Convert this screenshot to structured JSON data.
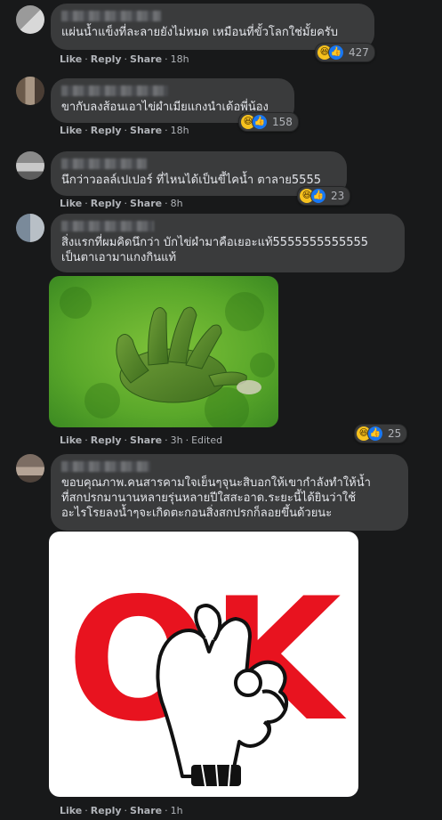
{
  "comments": [
    {
      "text": "แผ่นน้ำแข็งที่ละลายยังไม่หมด เหมือนที่ขั้วโลกใช่มั้ยครับ",
      "reaction_count": "427",
      "actions": {
        "like": "Like",
        "reply": "Reply",
        "share": "Share",
        "time": "18h"
      }
    },
    {
      "text": "ขากับลงส้อนเอาไข่ผำเมียแกงนำเด้อพี่น้อง",
      "reaction_count": "158",
      "actions": {
        "like": "Like",
        "reply": "Reply",
        "share": "Share",
        "time": "18h"
      }
    },
    {
      "text": "นึกว่าวอลล์เปเปอร์ ที่ไหนได้เป็นขี้ไคน้ำ ตาลาย5555",
      "reaction_count": "23",
      "actions": {
        "like": "Like",
        "reply": "Reply",
        "share": "Share",
        "time": "8h"
      }
    },
    {
      "text": "สิ่งแรกที่ผมคิดนึกว่า บักไข่ผำมาคือเยอะแท้5555555555555\nเป็นตาเอามาแกงกินแท้",
      "reaction_count": "25",
      "actions": {
        "like": "Like",
        "reply": "Reply",
        "share": "Share",
        "time": "3h",
        "edited": "Edited"
      }
    },
    {
      "text": "ขอบคุณภาพ.คนสารคามใจเย็นๆจุนะสิบอกให้เขากำลังทำให้น้ำ\nที่สกปรกมานานหลายรุ่นหลายปีใสสะอาด.ระยะนี้ได้ยินว่าใช้\nอะไรโรยลงน้ำๆจะเกิดตะกอนสิ่งสกปรกก็ลอยขึ้นด้วยนะ",
      "actions": {
        "like": "Like",
        "reply": "Reply",
        "share": "Share",
        "time": "1h"
      }
    }
  ],
  "sticker": {
    "letters": "OK"
  },
  "colors": {
    "bg": "#18191a",
    "bubble": "#3a3b3c",
    "text": "#e4e6eb",
    "muted": "#b0b3b8",
    "like_blue": "#1877f2",
    "haha_yellow": "#f7c21e",
    "ok_red": "#e8131f"
  },
  "icons": {
    "haha": "haha-emoji-icon",
    "like": "thumbs-up-icon"
  }
}
